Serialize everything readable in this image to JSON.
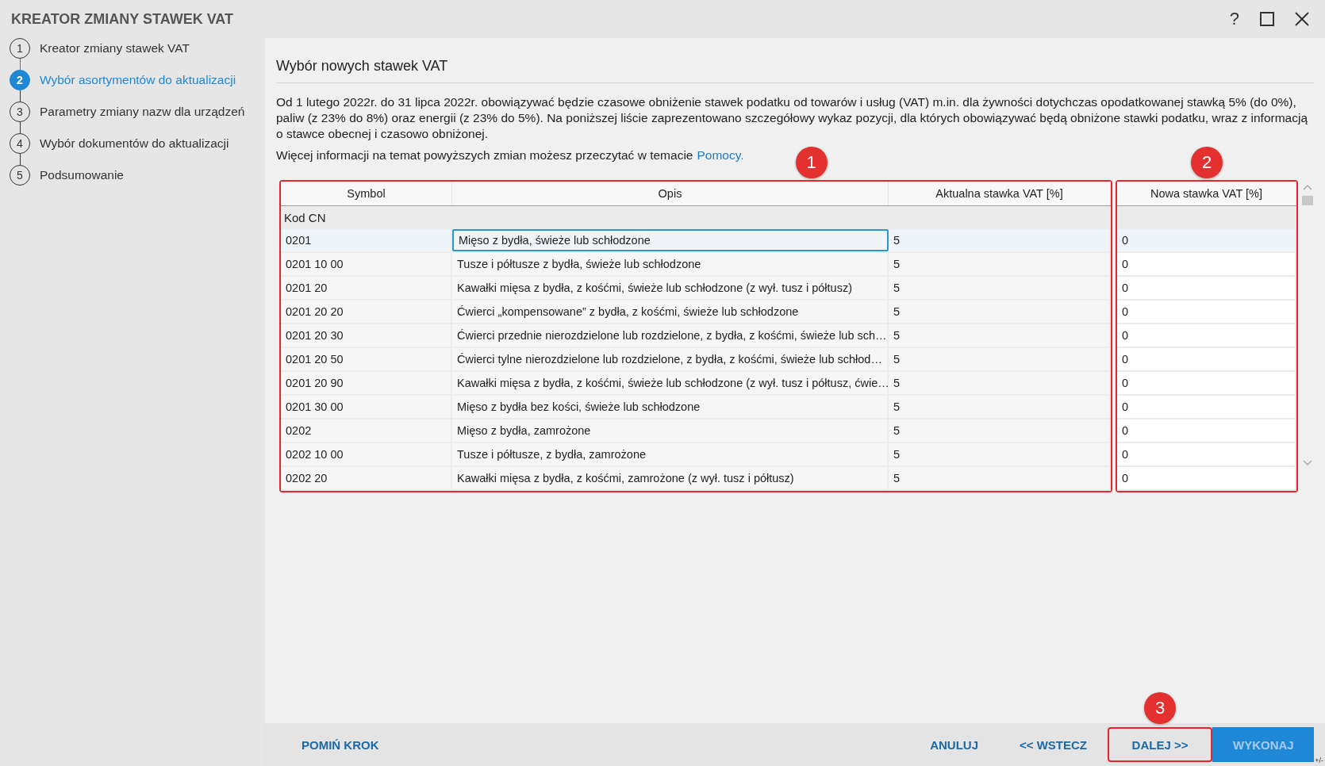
{
  "window": {
    "title": "KREATOR ZMIANY STAWEK VAT",
    "help": "?"
  },
  "sidebar": {
    "steps": [
      {
        "number": "1",
        "label": "Kreator zmiany stawek VAT",
        "selected": false
      },
      {
        "number": "2",
        "label": "Wybór asortymentów do aktualizacji",
        "selected": true
      },
      {
        "number": "3",
        "label": "Parametry zmiany nazw dla urządzeń",
        "selected": false
      },
      {
        "number": "4",
        "label": "Wybór dokumentów do aktualizacji",
        "selected": false
      },
      {
        "number": "5",
        "label": "Podsumowanie",
        "selected": false
      }
    ]
  },
  "content": {
    "heading": "Wybór nowych stawek VAT",
    "description": "Od 1 lutego 2022r. do 31 lipca 2022r. obowiązywać będzie czasowe obniżenie stawek podatku od towarów i usług (VAT) m.in. dla żywności dotychczas opodatkowanej stawką 5% (do 0%), paliw (z 23% do 8%) oraz energii (z 23% do 5%). Na poniższej liście zaprezentowano szczegółowy wykaz pozycji, dla których obowiązywać będą obniżone stawki podatku, wraz z informacją o stawce obecnej i czasowo obniżonej.",
    "more_info": "Więcej informacji na temat powyższych zmian możesz przeczytać w temacie",
    "help_link": "Pomocy."
  },
  "table": {
    "groups": [
      {
        "callout": "1",
        "columns": [
          "Symbol",
          "Opis",
          "Aktualna stawka VAT [%]"
        ],
        "group_label": "Kod CN"
      },
      {
        "callout": "2",
        "columns": [
          "Nowa stawka VAT [%]"
        ]
      }
    ],
    "rows": [
      {
        "cells": [
          "0201",
          "Mięso z bydła, świeże lub schłodzone",
          "5",
          "0"
        ],
        "selected": true
      },
      {
        "cells": [
          "0201 10 00",
          "Tusze i półtusze z bydła, świeże lub schłodzone",
          "5",
          "0"
        ],
        "selected": false
      },
      {
        "cells": [
          "0201 20",
          "Kawałki mięsa z bydła, z kośćmi, świeże lub schłodzone (z wył. tusz i półtusz)",
          "5",
          "0"
        ],
        "selected": false
      },
      {
        "cells": [
          "0201 20 20",
          "Ćwierci „kompensowane” z bydła, z kośćmi, świeże lub schłodzone",
          "5",
          "0"
        ],
        "selected": false
      },
      {
        "cells": [
          "0201 20 30",
          "Ćwierci przednie nierozdzielone lub rozdzielone, z bydła, z kośćmi, świeże lub sch…",
          "5",
          "0"
        ],
        "selected": false
      },
      {
        "cells": [
          "0201 20 50",
          "Ćwierci tylne nierozdzielone lub rozdzielone, z bydła, z kośćmi, świeże lub schłod…",
          "5",
          "0"
        ],
        "selected": false
      },
      {
        "cells": [
          "0201 20 90",
          "Kawałki mięsa z bydła, z kośćmi, świeże lub schłodzone (z wył. tusz i półtusz, ćwie…",
          "5",
          "0"
        ],
        "selected": false
      },
      {
        "cells": [
          "0201 30 00",
          "Mięso z bydła bez kości, świeże lub schłodzone",
          "5",
          "0"
        ],
        "selected": false
      },
      {
        "cells": [
          "0202",
          "Mięso z bydła, zamrożone",
          "5",
          "0"
        ],
        "selected": false
      },
      {
        "cells": [
          "0202 10 00",
          "Tusze i półtusze, z bydła, zamrożone",
          "5",
          "0"
        ],
        "selected": false
      },
      {
        "cells": [
          "0202 20",
          "Kawałki mięsa z bydła, z kośćmi, zamrożone (z wył. tusz i półtusz)",
          "5",
          "0"
        ],
        "selected": false
      }
    ]
  },
  "footer": {
    "buttons": [
      {
        "label": "POMIŃ KROK",
        "kind": "link",
        "disabled": false
      },
      {
        "label": "ANULUJ",
        "kind": "link",
        "disabled": false
      },
      {
        "label": "<< WSTECZ",
        "kind": "link",
        "disabled": false
      },
      {
        "label": "DALEJ >>",
        "kind": "link",
        "disabled": false,
        "callout": "3"
      },
      {
        "label": "WYKONAJ",
        "kind": "primary",
        "disabled": true
      }
    ],
    "corner_mark": "+/-"
  }
}
